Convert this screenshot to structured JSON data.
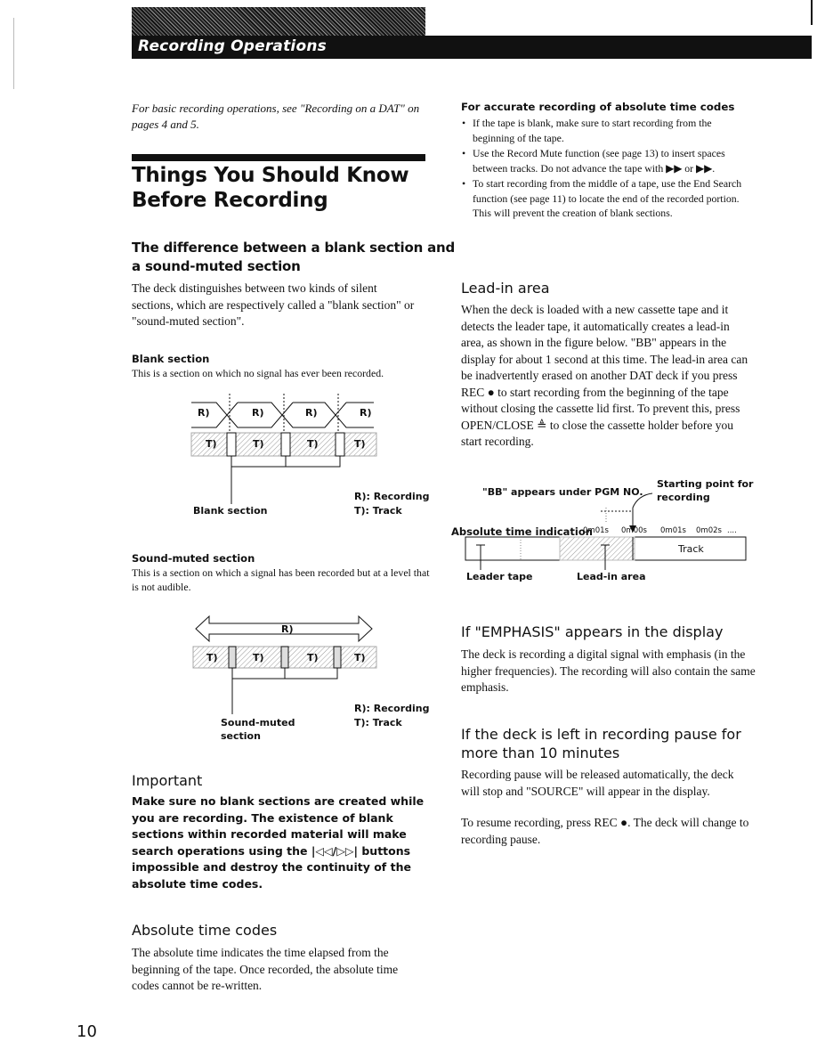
{
  "header": {
    "title": "Recording Operations"
  },
  "intro": {
    "text": "For basic recording operations, see \"Recording on a DAT\" on pages 4 and 5."
  },
  "main_title": {
    "line1": "Things You Should Know",
    "line2": "Before Recording"
  },
  "difference_section": {
    "heading_line1": "The difference between a blank section and",
    "heading_line2": "a sound-muted section",
    "body": "The deck distinguishes between two kinds of silent sections, which are respectively called a \"blank section\" or \"sound-muted section\"."
  },
  "blank_section": {
    "heading": "Blank section",
    "body": "This is a section on which no signal has ever been recorded.",
    "diagram": {
      "recording_labels": [
        "R)",
        "R)",
        "R)",
        "R)"
      ],
      "track_labels": [
        "T)",
        "T)",
        "T)",
        "T)"
      ],
      "caption": "Blank section",
      "legend": [
        "R): Recording",
        "T): Track"
      ]
    }
  },
  "sound_muted_section": {
    "heading": "Sound-muted section",
    "body": "This is a section on which a signal has been recorded but at a level that is not audible.",
    "diagram": {
      "recording_label": "R)",
      "track_labels": [
        "T)",
        "T)",
        "T)",
        "T)"
      ],
      "caption_line1": "Sound-muted",
      "caption_line2": "section",
      "legend": [
        "R): Recording",
        "T): Track"
      ]
    }
  },
  "important": {
    "heading": "Important",
    "body": "Make sure no blank sections are created while you are recording. The existence of blank sections within recorded material will make search operations using the |◁◁/▷▷| buttons impossible and destroy the continuity of the absolute time codes."
  },
  "absolute_time_codes": {
    "heading": "Absolute time codes",
    "body": "The absolute time indicates the time elapsed from the beginning of the tape. Once recorded, the absolute time codes cannot be re-written."
  },
  "accurate_recording": {
    "heading": "For accurate recording of absolute time codes",
    "bullets": [
      "If the tape is blank, make sure to start recording from the beginning of the tape.",
      "Use the Record Mute function (see page 13) to insert spaces between tracks. Do not advance the tape with ▶▶ or ▶▶.",
      "To start recording from the middle of a tape, use the End Search function (see page 11) to locate the end of the recorded portion. This will prevent the creation of blank sections."
    ]
  },
  "lead_in": {
    "heading": "Lead-in area",
    "body": "When the deck is loaded with a new cassette tape and it detects the leader tape, it automatically creates a lead-in area, as shown in the figure below. \"BB\" appears in the display for about 1 second at this time. The lead-in area can be inadvertently erased on another DAT deck if you press REC ● to start recording from the beginning of the tape without closing the cassette lid first. To prevent this, press OPEN/CLOSE ≜ to close the cassette holder before you start recording.",
    "diagram": {
      "bb_label": "\"BB\" appears under PGM NO.",
      "start_label_line1": "Starting point for",
      "start_label_line2": "recording",
      "abs_label": "Absolute time indication",
      "time_values": [
        "0m01s",
        "0m00s",
        "0m01s",
        "0m02s",
        "...."
      ],
      "track_label": "Track",
      "leader_label": "Leader tape",
      "leadin_label": "Lead-in area"
    }
  },
  "emphasis": {
    "heading": "If \"EMPHASIS\" appears in the display",
    "body": "The deck is recording a digital signal with emphasis (in the higher frequencies). The recording will also contain the same emphasis."
  },
  "pause": {
    "heading_line1": "If the deck is left in recording pause for",
    "heading_line2": "more than 10 minutes",
    "body1": "Recording pause will be released automatically, the deck will stop and \"SOURCE\" will appear in the display.",
    "body2": "To resume recording, press REC ●. The deck will change to recording pause."
  },
  "page_number": "10"
}
